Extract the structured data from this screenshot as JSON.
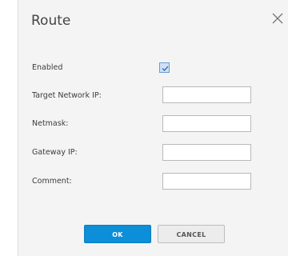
{
  "dialog": {
    "title": "Route"
  },
  "form": {
    "enabled_label": "Enabled",
    "enabled_checked": true,
    "target_label": "Target Network IP:",
    "target_value": "",
    "netmask_label": "Netmask:",
    "netmask_value": "",
    "gateway_label": "Gateway IP:",
    "gateway_value": "",
    "comment_label": "Comment:",
    "comment_value": ""
  },
  "buttons": {
    "ok_label": "OK",
    "cancel_label": "CANCEL"
  },
  "colors": {
    "primary": "#0c8ed8",
    "dialog_bg": "#f4f4f4",
    "checkbox_fill": "#cfe1f6"
  }
}
